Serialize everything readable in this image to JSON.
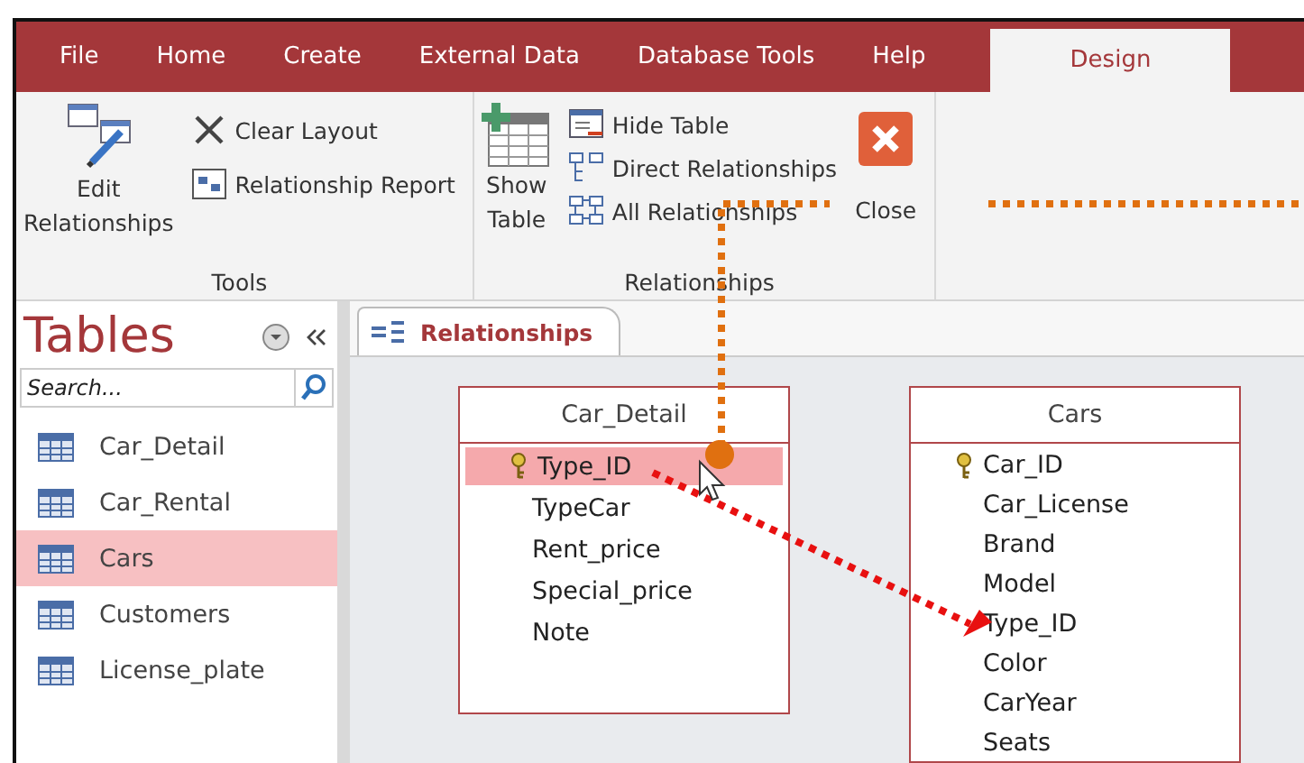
{
  "ribbon_tabs": [
    {
      "label": "File",
      "selected": false
    },
    {
      "label": "Home",
      "selected": false
    },
    {
      "label": "Create",
      "selected": false
    },
    {
      "label": "External Data",
      "selected": false
    },
    {
      "label": "Database Tools",
      "selected": false
    },
    {
      "label": "Help",
      "selected": false
    },
    {
      "label": "Design",
      "selected": true
    }
  ],
  "ribbon_groups": [
    {
      "label": "Tools",
      "large": [
        {
          "label": "Edit Relationships"
        }
      ],
      "small": [
        {
          "label": "Clear Layout"
        },
        {
          "label": "Relationship Report"
        }
      ]
    },
    {
      "label": "Relationships",
      "large": [
        {
          "label": "Show Table"
        }
      ],
      "small": [
        {
          "label": "Hide Table"
        },
        {
          "label": "Direct Relationships"
        },
        {
          "label": "All Relationships"
        }
      ],
      "trailing": [
        {
          "label": "Close"
        }
      ]
    }
  ],
  "nav_pane": {
    "title": "Tables",
    "search": {
      "placeholder": "Search..."
    },
    "items": [
      {
        "label": "Car_Detail",
        "selected": false
      },
      {
        "label": "Car_Rental",
        "selected": false
      },
      {
        "label": "Cars",
        "selected": true
      },
      {
        "label": "Customers",
        "selected": false
      },
      {
        "label": "License_plate",
        "selected": false
      }
    ]
  },
  "document_tab": {
    "label": "Relationships"
  },
  "tables": [
    {
      "title": "Car_Detail",
      "fields": [
        {
          "name": "Type_ID",
          "key": true,
          "selected": true
        },
        {
          "name": "TypeCar",
          "key": false,
          "selected": false
        },
        {
          "name": "Rent_price",
          "key": false,
          "selected": false
        },
        {
          "name": "Special_price",
          "key": false,
          "selected": false
        },
        {
          "name": "Note",
          "key": false,
          "selected": false
        }
      ]
    },
    {
      "title": "Cars",
      "fields": [
        {
          "name": "Car_ID",
          "key": true,
          "selected": false
        },
        {
          "name": "Car_License",
          "key": false,
          "selected": false
        },
        {
          "name": "Brand",
          "key": false,
          "selected": false
        },
        {
          "name": "Model",
          "key": false,
          "selected": false
        },
        {
          "name": "Type_ID",
          "key": false,
          "selected": false
        },
        {
          "name": "Color",
          "key": false,
          "selected": false
        },
        {
          "name": "CarYear",
          "key": false,
          "selected": false
        },
        {
          "name": "Seats",
          "key": false,
          "selected": false
        }
      ]
    }
  ]
}
